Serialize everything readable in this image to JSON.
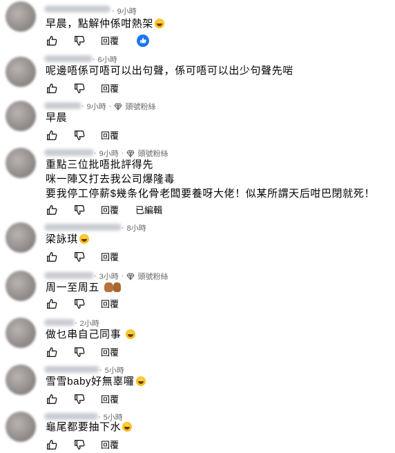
{
  "comments": [
    {
      "time": "9小時",
      "badge": "",
      "text": [
        "早晨，點解仲係咁熱架"
      ],
      "reply": "回覆",
      "edited": "",
      "reacted": true
    },
    {
      "time": "6小時",
      "badge": "",
      "text": [
        "呢邊唔係可唔可以出句聲，係可唔可以出少句聲先啱"
      ],
      "reply": "回覆",
      "edited": "",
      "reacted": false
    },
    {
      "time": "9小時",
      "badge": "頭號粉絲",
      "text": [
        "早晨"
      ],
      "reply": "回覆",
      "edited": "",
      "reacted": false
    },
    {
      "time": "9小時",
      "badge": "頭號粉絲",
      "text": [
        "重點三位批唔批評得先",
        "咪一陣又打去我公司爆隆毒",
        "要我停工停薪$幾条化骨老闆要養呀大佬！似某所謂天后咁巴閉就死！"
      ],
      "reply": "回覆",
      "edited": "已編輯",
      "reacted": false
    },
    {
      "time": "8小時",
      "badge": "",
      "text": [
        "梁詠琪"
      ],
      "reply": "回覆",
      "edited": "",
      "reacted": false
    },
    {
      "time": "3小時",
      "badge": "頭號粉絲",
      "text": [
        "周一至周五"
      ],
      "reply": "回覆",
      "edited": "",
      "reacted": false
    },
    {
      "time": "2小時",
      "badge": "",
      "text": [
        "做乜串自己同事"
      ],
      "reply": "回覆",
      "edited": "",
      "reacted": false
    },
    {
      "time": "5小時",
      "badge": "",
      "text": [
        "雪雪baby好無辜囉"
      ],
      "reply": "回覆",
      "edited": "",
      "reacted": false
    },
    {
      "time": "5小時",
      "badge": "",
      "text": [
        "龜尾都要抽下水"
      ],
      "reply": "回覆",
      "edited": "",
      "reacted": false
    }
  ],
  "icons": {
    "like": "thumbs-up-icon",
    "dislike": "thumbs-down-icon",
    "badge": "diamond-icon",
    "reaction": "like-reaction-icon",
    "emoji": "grinning-face-emoji",
    "hands": "clapping-thumbs-up-emoji"
  },
  "colors": {
    "meta": "#65676b",
    "text": "#050505",
    "like_blue": "#1877f2"
  }
}
